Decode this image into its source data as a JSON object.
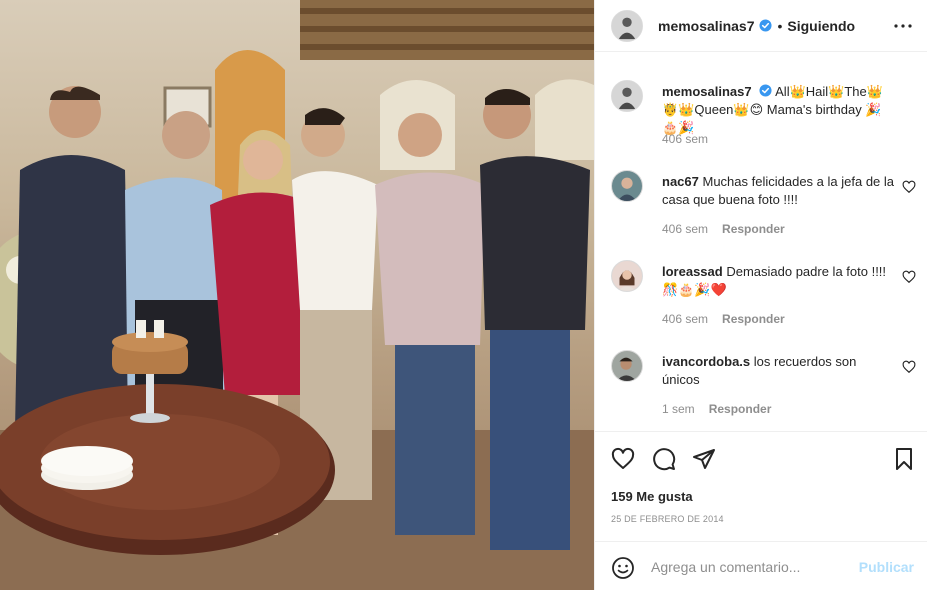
{
  "post": {
    "username": "memosalinas7",
    "separator": "•",
    "follow_label": "Siguiendo",
    "caption": "All👑Hail👑The👑🤴👑Queen👑😊 Mama's birthday 🎉🎂🎉",
    "caption_time": "406 sem",
    "likes": "159 Me gusta",
    "date": "25 DE FEBRERO DE 2014"
  },
  "comments": [
    {
      "user": "nac67",
      "text": "Muchas felicidades a la jefa de la casa que buena foto !!!!",
      "time": "406 sem",
      "reply": "Responder"
    },
    {
      "user": "loreassad",
      "text": "Demasiado padre la foto !!!! 🎊🎂🎉❤️",
      "time": "406 sem",
      "reply": "Responder"
    },
    {
      "user": "ivancordoba.s",
      "text": "los recuerdos son únicos",
      "time": "1 sem",
      "reply": "Responder"
    }
  ],
  "add_comment": {
    "placeholder": "Agrega un comentario...",
    "publish_label": "Publicar"
  },
  "icons": {
    "verified": "verified-badge-icon",
    "more": "more-options-icon",
    "like": "heart-icon",
    "comment": "comment-icon",
    "share": "share-icon",
    "save": "bookmark-icon",
    "emoji": "emoji-icon"
  },
  "colors": {
    "verified": "#3897f0",
    "publish_disabled": "#b2dffc",
    "meta_text": "#8e8e8e"
  }
}
